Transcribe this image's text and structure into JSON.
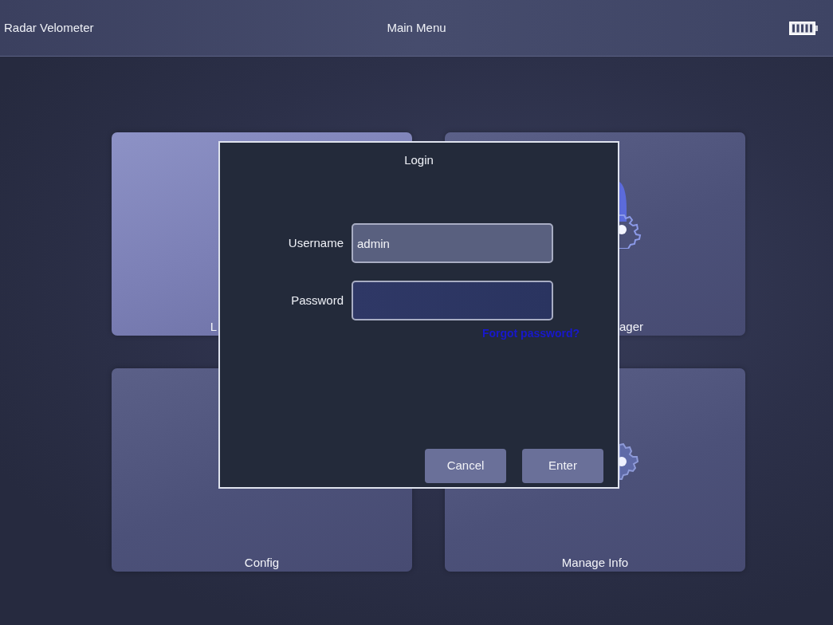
{
  "header": {
    "app_title": "Radar Velometer",
    "screen_title": "Main Menu"
  },
  "tiles": [
    {
      "label": "L",
      "selected": true
    },
    {
      "label": "ager",
      "selected": false
    },
    {
      "label": "Config",
      "selected": false
    },
    {
      "label": "Manage Info",
      "selected": false
    }
  ],
  "dialog": {
    "title": "Login",
    "fields": [
      {
        "label": "Username",
        "value": "admin",
        "kind": "combo"
      },
      {
        "label": "Password",
        "kind": "password"
      }
    ],
    "link": "Forgot password?",
    "buttons": [
      "Cancel",
      "Enter"
    ]
  }
}
